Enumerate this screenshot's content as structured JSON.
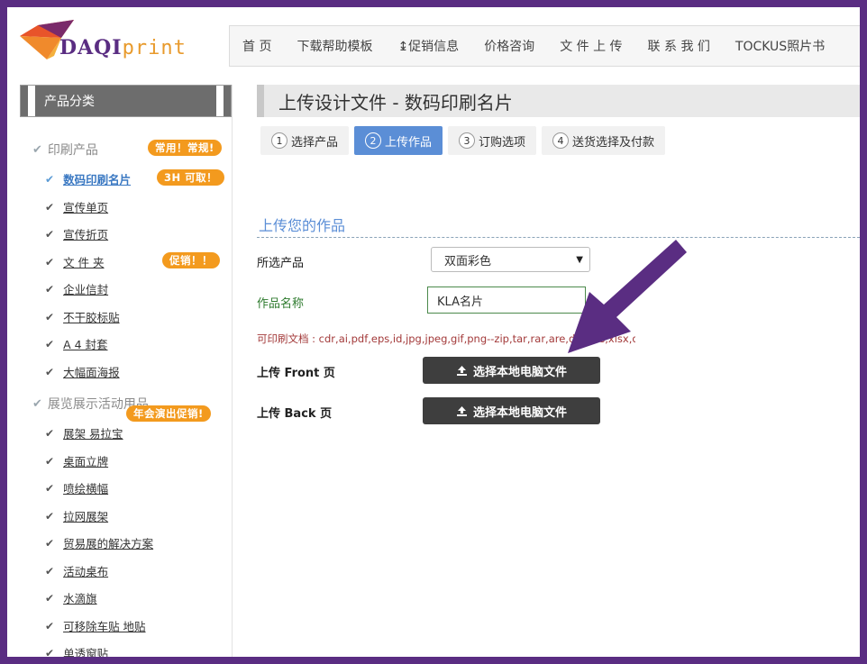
{
  "logo": {
    "daqi": "DAQI",
    "print": "print"
  },
  "nav": {
    "items": [
      {
        "label": "首 页"
      },
      {
        "label": "下载帮助模板"
      },
      {
        "label": "↨促销信息"
      },
      {
        "label": "价格咨询"
      },
      {
        "label": "文 件 上 传"
      },
      {
        "label": "联 系 我 们"
      },
      {
        "label": "TOCKUS照片书"
      }
    ]
  },
  "sidebar": {
    "title": "产品分类",
    "categories": [
      {
        "label": "印刷产品",
        "badge": "常用！常规!"
      },
      {
        "label": "展览展示活动用品",
        "badge": "年会演出促销!"
      }
    ],
    "items": [
      {
        "label": "数码印刷名片",
        "badge": "3H 可取！"
      },
      {
        "label": "宣传单页"
      },
      {
        "label": "宣传折页"
      },
      {
        "label": "文 件 夹",
        "badge": "促销！！"
      },
      {
        "label": "企业信封"
      },
      {
        "label": "不干胶标贴"
      },
      {
        "label": "A 4 封套"
      },
      {
        "label": "大幅面海报"
      },
      {
        "label": "展架 易拉宝"
      },
      {
        "label": "桌面立牌"
      },
      {
        "label": "喷绘横幅"
      },
      {
        "label": "拉网展架"
      },
      {
        "label": "贸易展的解决方案"
      },
      {
        "label": "活动桌布"
      },
      {
        "label": "水滴旗"
      },
      {
        "label": "可移除车贴 地贴"
      },
      {
        "label": "单透窗贴"
      }
    ]
  },
  "main": {
    "title": "上传设计文件 - 数码印刷名片",
    "steps": [
      {
        "num": "1",
        "label": "选择产品"
      },
      {
        "num": "2",
        "label": "上传作品"
      },
      {
        "num": "3",
        "label": "订购选项"
      },
      {
        "num": "4",
        "label": "送货选择及付款"
      }
    ],
    "section_title": "上传您的作品",
    "selected_product_label": "所选产品",
    "selected_product_value": "双面彩色",
    "work_name_label": "作品名称",
    "work_name_value": "KLA名片",
    "formats_text": "可印刷文档 : cdr,ai,pdf,eps,id,jpg,jpeg,gif,png--zip,tar,rar,are,doc,xls,xlsx,docx;",
    "upload_front_label": "上传 Front 页",
    "upload_back_label": "上传 Back 页",
    "upload_button_label": "选择本地电脑文件"
  },
  "colors": {
    "frame": "#5a2d82",
    "accent_blue": "#5b8ed6",
    "badge_orange": "#f39a1e",
    "arrow_purple": "#5a2d82"
  }
}
